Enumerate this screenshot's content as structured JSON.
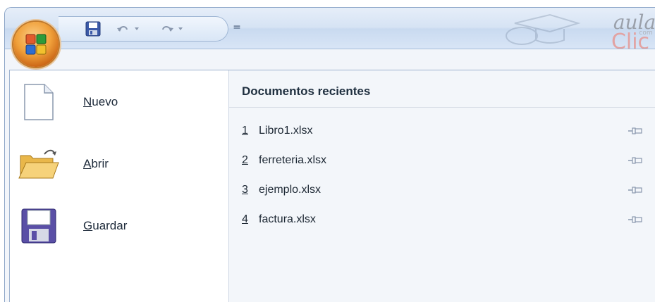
{
  "window": {
    "qat_more_glyph": "=",
    "watermark_text_top": "aula",
    "watermark_text_mid": "com",
    "watermark_text_bottom": "Clic"
  },
  "left_menu": {
    "items": [
      {
        "underlined": "N",
        "rest": "uevo",
        "icon": "new-document-icon"
      },
      {
        "underlined": "A",
        "rest": "brir",
        "icon": "open-folder-icon"
      },
      {
        "underlined": "G",
        "rest": "uardar",
        "icon": "save-disk-icon"
      }
    ]
  },
  "recent": {
    "title": "Documentos recientes",
    "items": [
      {
        "num": "1",
        "name": "Libro1.xlsx"
      },
      {
        "num": "2",
        "name": "ferreteria.xlsx"
      },
      {
        "num": "3",
        "name": "ejemplo.xlsx"
      },
      {
        "num": "4",
        "name": "factura.xlsx"
      }
    ]
  },
  "colors": {
    "accent": "#f0a03a",
    "title_bar": "#d6e3f4",
    "panel_right": "#f3f6fa"
  }
}
